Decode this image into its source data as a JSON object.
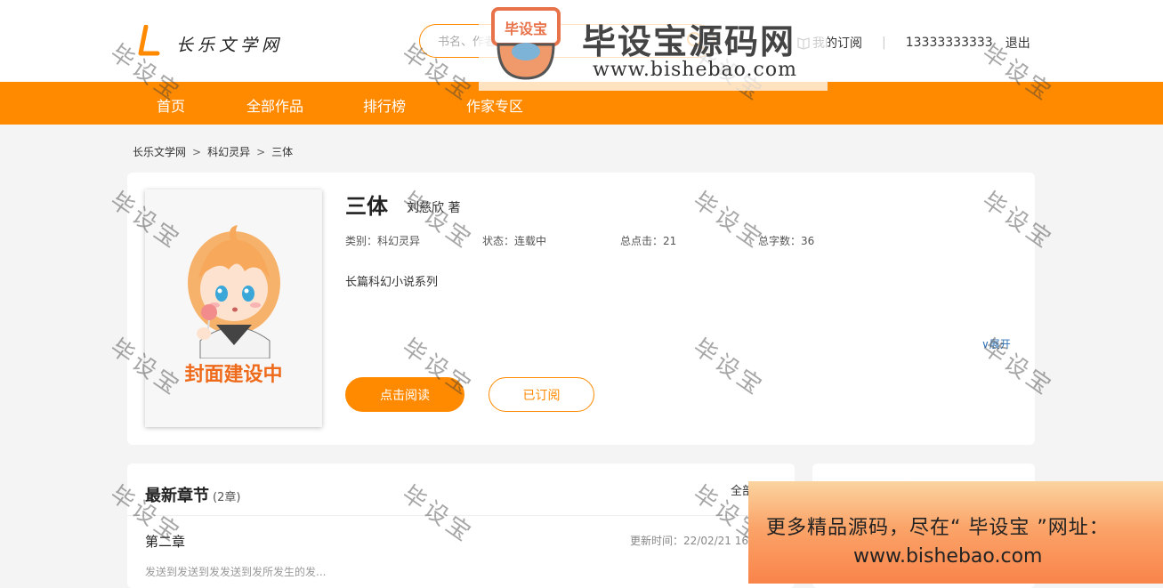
{
  "header": {
    "logo_text": "长乐文学网",
    "search_placeholder": "书名、作者、关键字",
    "my_subscriptions": "我的订阅",
    "phone": "13333333333",
    "logout": "退出"
  },
  "nav": {
    "items": [
      "首页",
      "全部作品",
      "排行榜",
      "作家专区"
    ]
  },
  "breadcrumb": [
    "长乐文学网",
    "科幻灵异",
    "三体"
  ],
  "breadcrumb_sep": ">",
  "book": {
    "cover_text": "封面建设中",
    "title": "三体",
    "author": "刘慈欣 著",
    "category": "类别：科幻灵异",
    "status": "状态：连载中",
    "clicks": "总点击：21",
    "word_count": "总字数：36",
    "intro": "长篇科幻小说系列",
    "expand": "∨展开",
    "read_button": "点击阅读",
    "subscribed_button": "已订阅"
  },
  "chapters": {
    "title": "最新章节",
    "count": "(2章)",
    "all_link": "全部",
    "latest": {
      "name": "第二章",
      "updated": "更新时间：22/02/21 16:",
      "excerpt": "发送到发送到发发送到发所发生的发..."
    }
  },
  "watermark": {
    "text": "毕设宝",
    "brand_badge": "毕设宝",
    "brand_title": "毕设宝源码网",
    "brand_url": "www.bishebao.com",
    "ad_line1": "更多精品源码，尽在“ 毕设宝 ”网址：",
    "ad_line2": "www.bishebao.com"
  },
  "colors": {
    "accent": "#ff8a00",
    "nav_bg": "#ff8a00",
    "page_bg": "#f4f4f4",
    "link_blue": "#2a6fb5"
  }
}
